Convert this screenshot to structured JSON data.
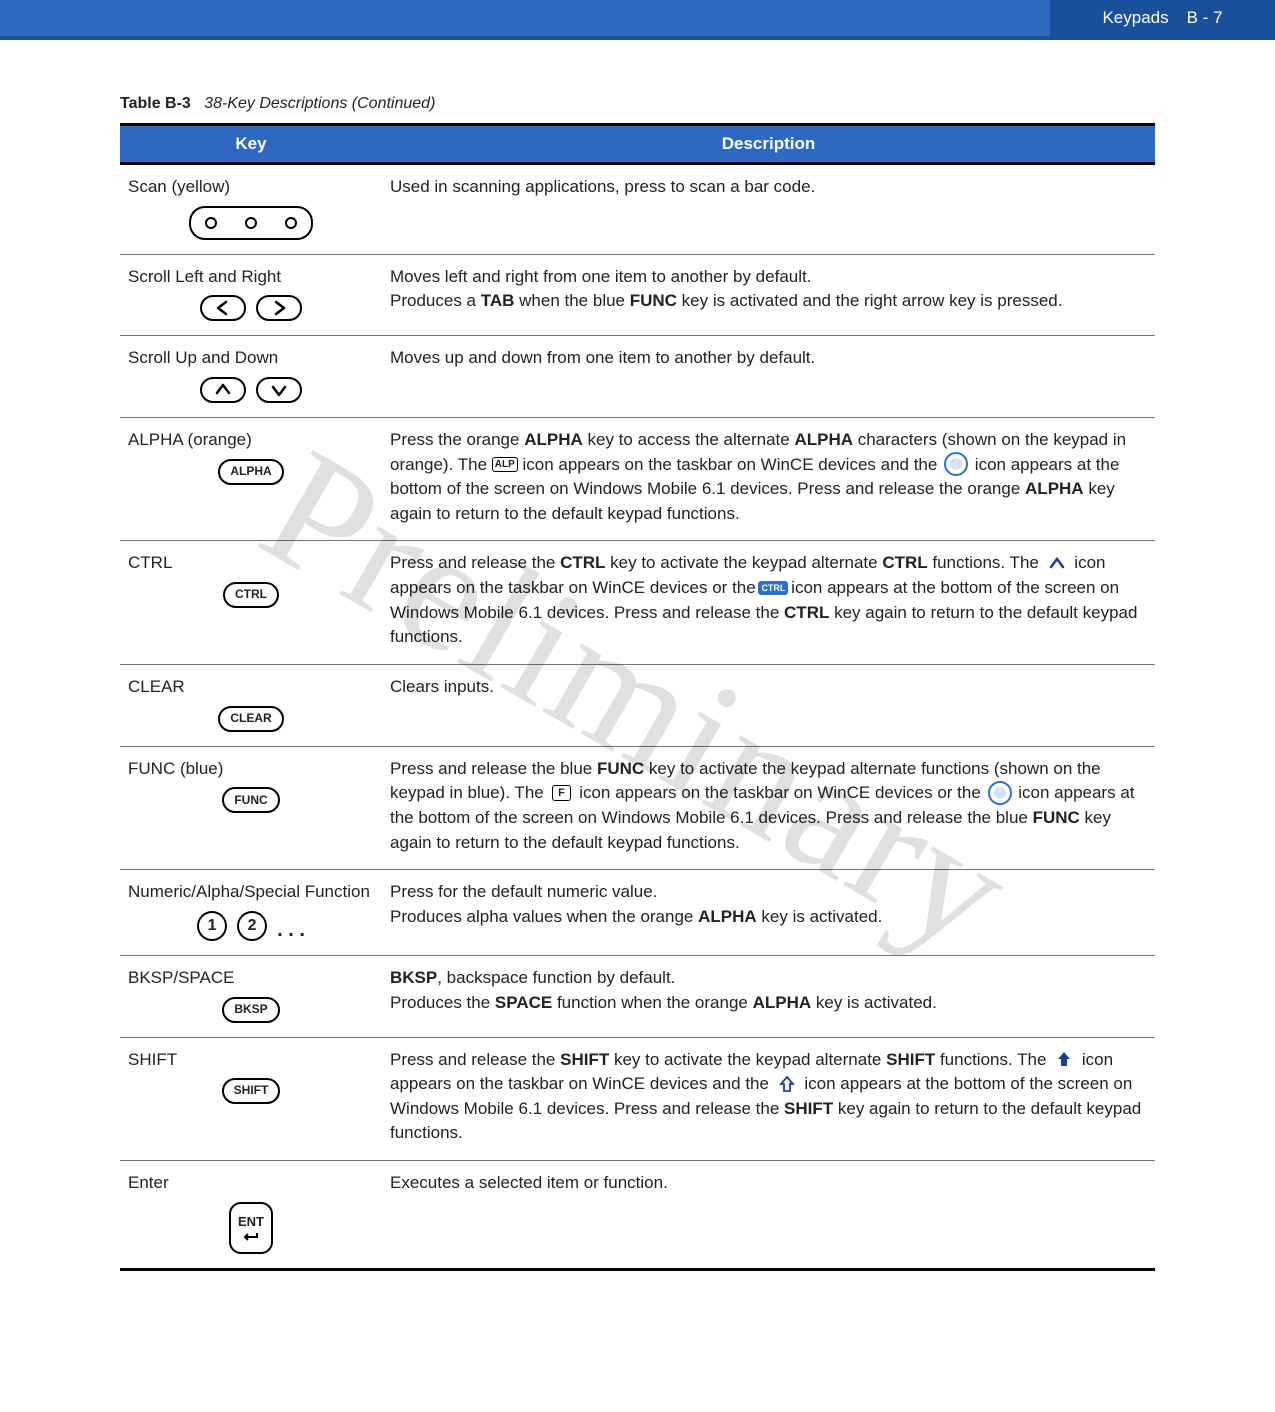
{
  "header": {
    "section": "Keypads",
    "page": "B - 7"
  },
  "watermark": "Preliminary",
  "caption": {
    "label": "Table B-3",
    "title": "38-Key Descriptions (Continued)"
  },
  "columns": {
    "key": "Key",
    "description": "Description"
  },
  "rows": [
    {
      "key_name": "Scan (yellow)",
      "icon": "scan",
      "desc_parts": [
        {
          "t": "Used in scanning applications, press to scan a bar code."
        }
      ]
    },
    {
      "key_name": "Scroll Left and Right",
      "icon": "lr",
      "desc_parts": [
        {
          "t": "Moves left and right from one item to another by default."
        },
        {
          "br": true
        },
        {
          "t": "Produces a "
        },
        {
          "b": "TAB"
        },
        {
          "t": " when the blue "
        },
        {
          "b": "FUNC"
        },
        {
          "t": " key is activated and the right arrow key is pressed."
        }
      ]
    },
    {
      "key_name": "Scroll Up and Down",
      "icon": "ud",
      "desc_parts": [
        {
          "t": "Moves up and down from one item to another by default."
        }
      ]
    },
    {
      "key_name": "ALPHA (orange)",
      "icon": "alpha",
      "desc_parts": [
        {
          "t": "Press the orange "
        },
        {
          "b": "ALPHA"
        },
        {
          "t": " key to access the alternate "
        },
        {
          "b": "ALPHA"
        },
        {
          "t": " characters (shown on the keypad in orange). The "
        },
        {
          "ico": "alp"
        },
        {
          "t": " icon appears on the taskbar on WinCE devices and the "
        },
        {
          "ico": "circle"
        },
        {
          "t": " icon appears at the bottom of the screen on Windows Mobile 6.1 devices. Press and release the orange "
        },
        {
          "b": "ALPHA"
        },
        {
          "t": " key again to return to the default keypad functions."
        }
      ]
    },
    {
      "key_name": "CTRL",
      "icon": "ctrl",
      "desc_parts": [
        {
          "t": "Press and release the "
        },
        {
          "b": "CTRL"
        },
        {
          "t": " key to activate the keypad alternate "
        },
        {
          "b": "CTRL"
        },
        {
          "t": " functions. The "
        },
        {
          "ico": "caret"
        },
        {
          "t": " icon appears on the taskbar on WinCE devices or the "
        },
        {
          "ico": "ctrlbox"
        },
        {
          "t": " icon appears at the bottom of the screen on Windows Mobile 6.1 devices. Press and release the "
        },
        {
          "b": "CTRL"
        },
        {
          "t": " key again to return to the default keypad functions."
        }
      ]
    },
    {
      "key_name": "CLEAR",
      "icon": "clear",
      "desc_parts": [
        {
          "t": "Clears inputs."
        }
      ]
    },
    {
      "key_name": "FUNC (blue)",
      "icon": "func",
      "desc_parts": [
        {
          "t": "Press and release the blue "
        },
        {
          "b": "FUNC"
        },
        {
          "t": " key to activate the keypad alternate functions (shown on the keypad in blue). The "
        },
        {
          "ico": "fbox"
        },
        {
          "t": " icon appears on the taskbar on WinCE devices or the "
        },
        {
          "ico": "circle"
        },
        {
          "t": " icon appears at the bottom of the screen on Windows Mobile 6.1 devices. Press and release the blue "
        },
        {
          "b": "FUNC"
        },
        {
          "t": " key again to return to the default keypad functions."
        }
      ]
    },
    {
      "key_name": "Numeric/Alpha/Special Function",
      "icon": "numalpha",
      "desc_parts": [
        {
          "t": "Press for the default numeric value."
        },
        {
          "br": true
        },
        {
          "t": "Produces alpha values when the orange "
        },
        {
          "b": "ALPHA"
        },
        {
          "t": " key is activated."
        }
      ]
    },
    {
      "key_name": "BKSP/SPACE",
      "icon": "bksp",
      "desc_parts": [
        {
          "b": "BKSP"
        },
        {
          "t": ", backspace function by default."
        },
        {
          "br": true
        },
        {
          "t": "Produces the "
        },
        {
          "b": "SPACE"
        },
        {
          "t": " function when the orange "
        },
        {
          "b": "ALPHA"
        },
        {
          "t": " key is activated."
        }
      ]
    },
    {
      "key_name": "SHIFT",
      "icon": "shift",
      "desc_parts": [
        {
          "t": "Press and release the "
        },
        {
          "b": "SHIFT"
        },
        {
          "t": " key to activate the keypad alternate "
        },
        {
          "b": "SHIFT"
        },
        {
          "t": " functions. The "
        },
        {
          "ico": "uparrow"
        },
        {
          "t": " icon appears on the taskbar on WinCE devices and the "
        },
        {
          "ico": "upoutline"
        },
        {
          "t": " icon appears at the bottom of the screen on Windows Mobile 6.1 devices. Press and release the "
        },
        {
          "b": "SHIFT"
        },
        {
          "t": " key again to return to the default keypad functions."
        }
      ]
    },
    {
      "key_name": "Enter",
      "icon": "enter",
      "desc_parts": [
        {
          "t": "Executes a selected item or function."
        }
      ]
    }
  ],
  "key_labels": {
    "alpha": "ALPHA",
    "ctrl": "CTRL",
    "clear": "CLEAR",
    "func": "FUNC",
    "bksp": "BKSP",
    "shift": "SHIFT",
    "ent": "ENT",
    "one": "1",
    "two": "2",
    "dots": ". . ."
  },
  "inline_icons": {
    "alp": "ALP",
    "ctrlbox": "CTRL",
    "fbox": "F"
  }
}
